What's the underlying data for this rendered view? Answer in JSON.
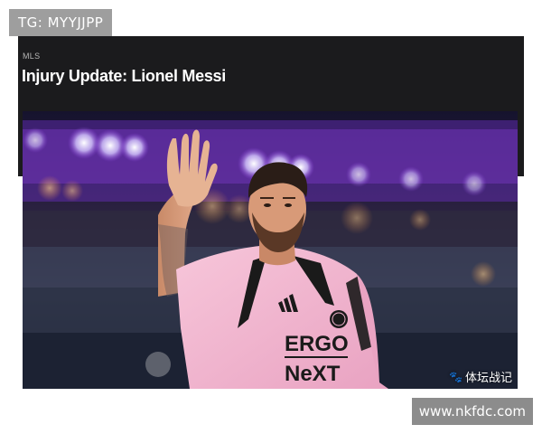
{
  "watermark_top": {
    "text": "TG: MYYJJPP"
  },
  "watermark_bottom": {
    "text": "www.nkfdc.com"
  },
  "article": {
    "category": "MLS",
    "headline": "Injury Update: Lionel Messi"
  },
  "photo": {
    "subject": "soccer player in pink jersey waving",
    "jersey_sponsor_line1": "ERGO",
    "jersey_sponsor_line2": "NeXT",
    "credit": "体坛战记",
    "credit_icon": "paw-icon"
  },
  "colors": {
    "header_bg": "#1b1b1d",
    "jersey_pink": "#f2b6cf",
    "stadium_purple": "#8b3fe0"
  }
}
